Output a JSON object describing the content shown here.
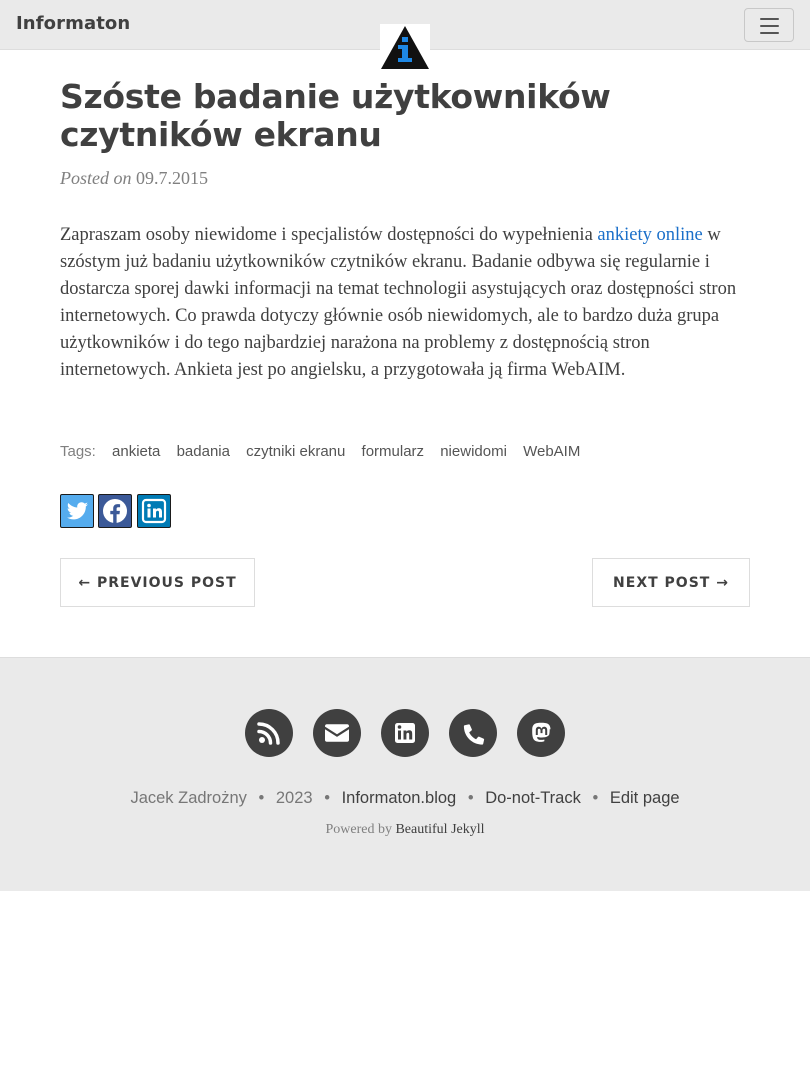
{
  "navbar": {
    "brand": "Informaton",
    "logo_icon": "information-logo-icon",
    "menu_icon": "hamburger-menu-icon"
  },
  "post": {
    "title": "Szóste badanie użytkowników czytników ekranu",
    "posted_on_label": "Posted on",
    "date": "09.7.2015",
    "body_before_link": "Zapraszam osoby niewidome i specjalistów dostępności do wypełnienia ",
    "link_text": "ankiety online",
    "body_after_link": " w szóstym już badaniu użytkowników czytników ekranu. Badanie odbywa się regularnie i dostarcza sporej dawki informacji na temat technologii asystujących oraz dostępności stron internetowych. Co prawda dotyczy głównie osób niewidomych, ale to bardzo duża grupa użytkowników i do tego najbardziej narażona na problemy z dostępnością stron internetowych. Ankieta jest po angielsku, a przygotowała ją firma WebAIM.",
    "tags_label": "Tags:",
    "tags": [
      "ankieta",
      "badania",
      "czytniki ekranu",
      "formularz",
      "niewidomi",
      "WebAIM"
    ]
  },
  "share": [
    {
      "icon": "twitter-icon",
      "color": "#55acee"
    },
    {
      "icon": "facebook-icon",
      "color": "#3b5998"
    },
    {
      "icon": "linkedin-icon",
      "color": "#007bb5"
    }
  ],
  "pager": {
    "previous": "← PREVIOUS POST",
    "next": "NEXT POST →"
  },
  "footer": {
    "icons": [
      "rss-icon",
      "envelope-icon",
      "linkedin-icon",
      "phone-icon",
      "mastodon-icon"
    ],
    "author": "Jacek Zadrożny",
    "year": "2023",
    "site": "Informaton.blog",
    "dnt": "Do-not-Track",
    "edit": "Edit page",
    "separator": "•",
    "powered_by_label": "Powered by",
    "powered_by_link": "Beautiful Jekyll"
  },
  "colors": {
    "link": "#1a6fc9",
    "footer_bg": "#eaeaea",
    "text": "#404040"
  }
}
